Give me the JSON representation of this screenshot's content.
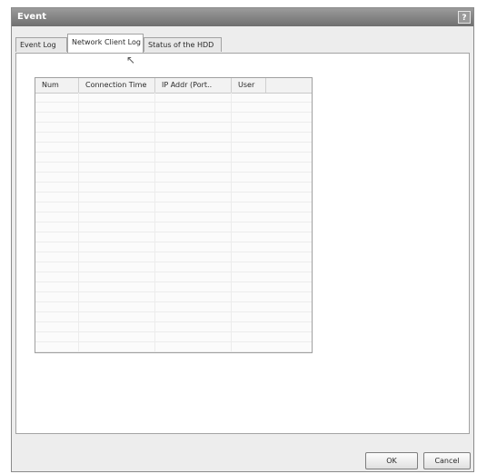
{
  "window": {
    "title": "Event"
  },
  "titlebar": {
    "help_label": "?"
  },
  "tabs": [
    {
      "label": "Event Log"
    },
    {
      "label": "Network Client Log"
    },
    {
      "label": "Status of the HDD"
    }
  ],
  "active_tab": "Network Client Log",
  "listview": {
    "columns": [
      "Num",
      "Connection Time",
      "IP Addr (Port..",
      "User"
    ],
    "rows": []
  },
  "buttons": {
    "ok": "OK",
    "cancel": "Cancel"
  },
  "colors": {
    "titlebar": "#7f7f7f",
    "dialog_bg": "#ededed",
    "panel_bg": "#ffffff"
  }
}
